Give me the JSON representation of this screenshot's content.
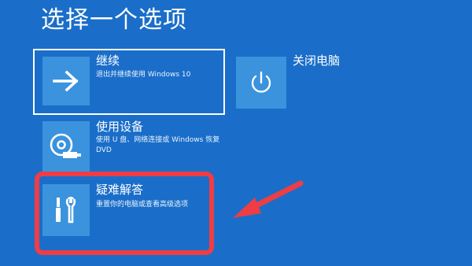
{
  "page": {
    "title": "选择一个选项"
  },
  "options": [
    {
      "id": "continue",
      "title": "继续",
      "description": "退出并继续使用 Windows 10",
      "icon": "arrow-right-icon"
    },
    {
      "id": "shutdown",
      "title": "关闭电脑",
      "description": "",
      "icon": "power-icon"
    },
    {
      "id": "use-device",
      "title": "使用设备",
      "description": "使用 U 盘、网络连接或 Windows 恢复 DVD",
      "icon": "disc-usb-icon"
    },
    {
      "id": "troubleshoot",
      "title": "疑难解答",
      "description": "重置你的电脑或查看高级选项",
      "icon": "tools-icon"
    }
  ],
  "colors": {
    "background": "#1a6ec9",
    "tile": "#3a93dc",
    "annotation": "#ee3d44",
    "text": "#ffffff"
  },
  "annotations": {
    "highlight_target": "troubleshoot"
  }
}
